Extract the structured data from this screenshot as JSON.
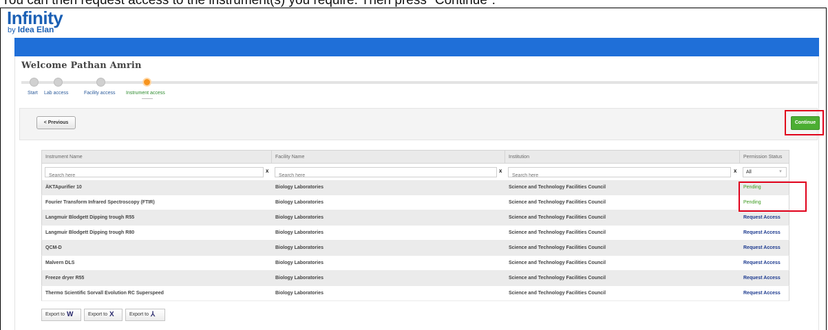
{
  "instruction": "You can then request access to the instrument(s) you require. Then press \"Continue\".",
  "logo": {
    "main": "Infinity",
    "sub_prefix": "by",
    "sub_brand": "Idea Elan"
  },
  "welcome": "Welcome Pathan Amrin",
  "wizard": {
    "steps": [
      {
        "label": "Start",
        "active": false
      },
      {
        "label": "Lab access",
        "active": false
      },
      {
        "label": "Facility access",
        "active": false
      },
      {
        "label": "Instrument access",
        "active": true
      }
    ]
  },
  "actions": {
    "previous": "< Previous",
    "continue": "Continue"
  },
  "grid": {
    "columns": [
      "Instrument Name",
      "Facility Name",
      "Institution",
      "Permission Status"
    ],
    "filters": {
      "instrument_placeholder": "Search here",
      "facility_placeholder": "Search here",
      "institution_placeholder": "Search here",
      "clear": "x",
      "status_selected": "All"
    },
    "rows": [
      {
        "instrument": "ÄKTApurifier 10",
        "facility": "Biology Laboratories",
        "institution": "Science and Technology Facilities Council",
        "status": "Pending"
      },
      {
        "instrument": "Fourier Transform Infrared Spectroscopy (FTIR)",
        "facility": "Biology Laboratories",
        "institution": "Science and Technology Facilities Council",
        "status": "Pending"
      },
      {
        "instrument": "Langmuir Blodgett Dipping trough R55",
        "facility": "Biology Laboratories",
        "institution": "Science and Technology Facilities Council",
        "status": "Request Access"
      },
      {
        "instrument": "Langmuir Blodgett Dipping trough R80",
        "facility": "Biology Laboratories",
        "institution": "Science and Technology Facilities Council",
        "status": "Request Access"
      },
      {
        "instrument": "QCM-D",
        "facility": "Biology Laboratories",
        "institution": "Science and Technology Facilities Council",
        "status": "Request Access"
      },
      {
        "instrument": "Malvern DLS",
        "facility": "Biology Laboratories",
        "institution": "Science and Technology Facilities Council",
        "status": "Request Access"
      },
      {
        "instrument": "Freeze dryer R55",
        "facility": "Biology Laboratories",
        "institution": "Science and Technology Facilities Council",
        "status": "Request Access"
      },
      {
        "instrument": "Thermo Scientific Sorvall Evolution RC Superspeed",
        "facility": "Biology Laboratories",
        "institution": "Science and Technology Facilities Council",
        "status": "Request Access"
      }
    ]
  },
  "export": [
    {
      "label": "Export to",
      "icon": "W"
    },
    {
      "label": "Export to",
      "icon": "X"
    },
    {
      "label": "Export to",
      "icon": "⅄"
    }
  ],
  "colors": {
    "blue_bar": "#1f6fd8",
    "continue_green": "#4cae32",
    "highlight_red": "#e0001a",
    "active_step": "#f7941d"
  }
}
